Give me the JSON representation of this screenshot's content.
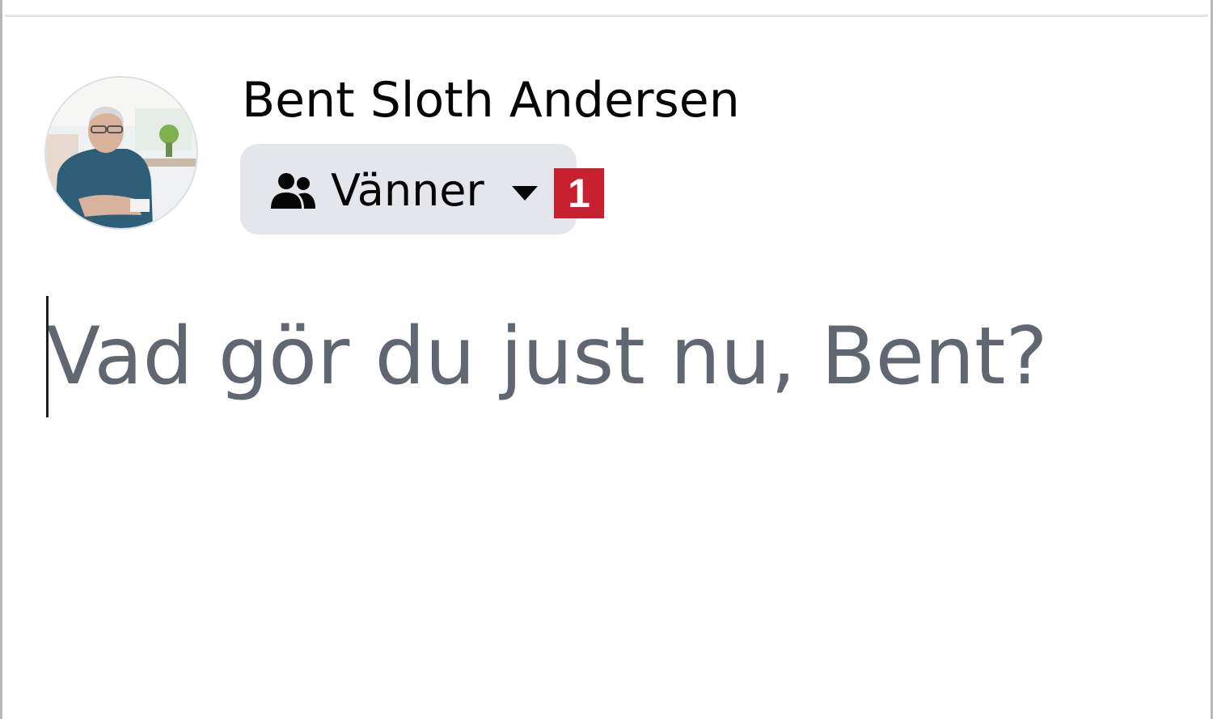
{
  "post_composer": {
    "author_name": "Bent Sloth Andersen",
    "audience": {
      "label": "Vänner",
      "icon": "friends-icon",
      "dropdown_icon": "caret-down-icon"
    },
    "step_badge": "1",
    "placeholder": "Vad gör du just nu, Bent?"
  },
  "colors": {
    "audience_pill_bg": "#e4e6eb",
    "badge_red": "#c8202f",
    "placeholder_gray": "#606770",
    "name_text": "#050505"
  }
}
